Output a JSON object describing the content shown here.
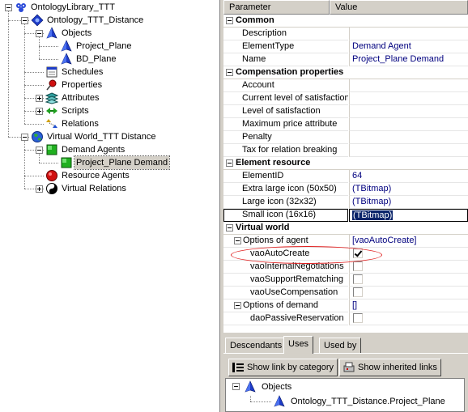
{
  "tree": {
    "nodes": [
      {
        "label": "OntologyLibrary_TTT",
        "icon": "ontology-library-icon",
        "expander": "minus"
      },
      {
        "label": "Ontology_TTT_Distance",
        "icon": "ontology-icon",
        "expander": "minus"
      },
      {
        "label": "Objects",
        "icon": "blue-pyramid-icon",
        "expander": "minus"
      },
      {
        "label": "Project_Plane",
        "icon": "blue-pyramid-icon",
        "expander": "none"
      },
      {
        "label": "BD_Plane",
        "icon": "blue-pyramid-icon",
        "expander": "none"
      },
      {
        "label": "Schedules",
        "icon": "calendar-icon",
        "expander": "none"
      },
      {
        "label": "Properties",
        "icon": "pushpin-icon",
        "expander": "none"
      },
      {
        "label": "Attributes",
        "icon": "layers-icon",
        "expander": "plus"
      },
      {
        "label": "Scripts",
        "icon": "script-arrows-icon",
        "expander": "plus"
      },
      {
        "label": "Relations",
        "icon": "relations-icon",
        "expander": "none"
      },
      {
        "label": "Virtual World_TTT Distance",
        "icon": "globe-icon",
        "expander": "minus"
      },
      {
        "label": "Demand Agents",
        "icon": "green-square-icon",
        "expander": "minus"
      },
      {
        "label": "Project_Plane Demand",
        "icon": "green-square-icon",
        "expander": "none",
        "selected": true
      },
      {
        "label": "Resource Agents",
        "icon": "red-ball-icon",
        "expander": "none"
      },
      {
        "label": "Virtual Relations",
        "icon": "yin-yang-icon",
        "expander": "plus"
      }
    ]
  },
  "inspector": {
    "header": {
      "parameter": "Parameter",
      "value": "Value"
    },
    "rows": [
      {
        "kind": "cat",
        "name": "Common"
      },
      {
        "kind": "prop",
        "name": "Description",
        "value": ""
      },
      {
        "kind": "prop",
        "name": "ElementType",
        "value": "Demand Agent"
      },
      {
        "kind": "prop",
        "name": "Name",
        "value": "Project_Plane Demand"
      },
      {
        "kind": "cat",
        "name": "Compensation properties"
      },
      {
        "kind": "prop",
        "name": "Account",
        "value": ""
      },
      {
        "kind": "prop",
        "name": "Current level of satisfaction",
        "value": ""
      },
      {
        "kind": "prop",
        "name": "Level of satisfaction",
        "value": ""
      },
      {
        "kind": "prop",
        "name": "Maximum price attribute",
        "value": ""
      },
      {
        "kind": "prop",
        "name": "Penalty",
        "value": ""
      },
      {
        "kind": "prop",
        "name": "Tax for relation breaking",
        "value": ""
      },
      {
        "kind": "cat",
        "name": "Element resource"
      },
      {
        "kind": "prop",
        "name": "ElementID",
        "value": "64"
      },
      {
        "kind": "prop",
        "name": "Extra large icon (50x50)",
        "value": "(TBitmap)"
      },
      {
        "kind": "prop",
        "name": "Large icon (32x32)",
        "value": "(TBitmap)"
      },
      {
        "kind": "prop",
        "name": "Small icon (16x16)",
        "value": "(TBitmap)",
        "selected": true
      },
      {
        "kind": "cat",
        "name": "Virtual world"
      },
      {
        "kind": "sub",
        "name": "Options of agent",
        "value": "[vaoAutoCreate]"
      },
      {
        "kind": "check",
        "name": "vaoAutoCreate",
        "checked": true
      },
      {
        "kind": "check",
        "name": "vaoInternalNegotiations",
        "checked": false
      },
      {
        "kind": "check",
        "name": "vaoSupportRematching",
        "checked": false
      },
      {
        "kind": "check",
        "name": "vaoUseCompensation",
        "checked": false
      },
      {
        "kind": "sub",
        "name": "Options of demand",
        "value": "[]"
      },
      {
        "kind": "check",
        "name": "daoPassiveReservation",
        "checked": false
      }
    ]
  },
  "bottom": {
    "tabs": [
      "Descendants",
      "Uses",
      "Used by"
    ],
    "active_tab": "Uses",
    "buttons": {
      "show_by_category": "Show link by category",
      "show_inherited": "Show inherited links"
    },
    "uses_tree": [
      {
        "label": "Objects",
        "icon": "blue-pyramid-icon"
      },
      {
        "label": "Ontology_TTT_Distance.Project_Plane",
        "icon": "blue-pyramid-icon"
      }
    ]
  },
  "colors": {
    "value_text": "#00007f",
    "selection": "#0a246a",
    "annotation_ellipse": "#e02020"
  }
}
